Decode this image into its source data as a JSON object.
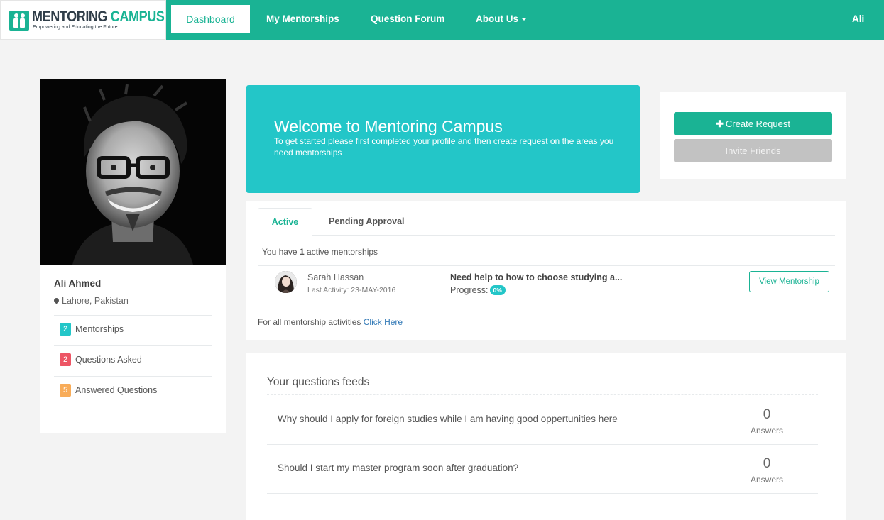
{
  "brand": {
    "title_part1": "MENTORING",
    "title_part2": "CAMPUS",
    "tagline": "Empowering and Educating the Future"
  },
  "nav": {
    "dashboard": "Dashboard",
    "my_mentorships": "My Mentorships",
    "question_forum": "Question Forum",
    "about_us": "About Us",
    "user": "Ali"
  },
  "profile": {
    "name": "Ali Ahmed",
    "location": "Lahore, Pakistan",
    "stats": [
      {
        "count": "2",
        "label": "Mentorships",
        "color": "#23c6c8"
      },
      {
        "count": "2",
        "label": "Questions Asked",
        "color": "#ed5565"
      },
      {
        "count": "5",
        "label": "Answered Questions",
        "color": "#f8ac59"
      }
    ]
  },
  "welcome": {
    "title": "Welcome to Mentoring Campus",
    "text": "To get started please first completed your profile and then create request on the areas you need mentorships"
  },
  "actions": {
    "create_request": "Create Request",
    "invite_friends": "Invite Friends"
  },
  "mentorships": {
    "tabs": [
      "Active",
      "Pending Approval"
    ],
    "count_prefix": "You have",
    "count": "1",
    "count_suffix": "active mentorships",
    "row": {
      "mentor_name": "Sarah Hassan",
      "last_activity": "Last Activity: 23-MAY-2016",
      "topic": "Need help to how to choose studying a...",
      "progress_label": "Progress:",
      "progress_value": "0%",
      "view_button": "View Mentorship"
    },
    "all_activities_text": "For all mentorship activities",
    "all_activities_link": "Click Here"
  },
  "feed": {
    "title": "Your questions feeds",
    "questions": [
      {
        "text": "Why should I apply for foreign studies while I am having good oppertunities here",
        "count": "0",
        "label": "Answers"
      },
      {
        "text": "Should I start my master program soon after graduation?",
        "count": "0",
        "label": "Answers"
      }
    ]
  },
  "colors": {
    "brand": "#1ab394",
    "info": "#23c6c8",
    "danger": "#ed5565",
    "warning": "#f8ac59"
  }
}
